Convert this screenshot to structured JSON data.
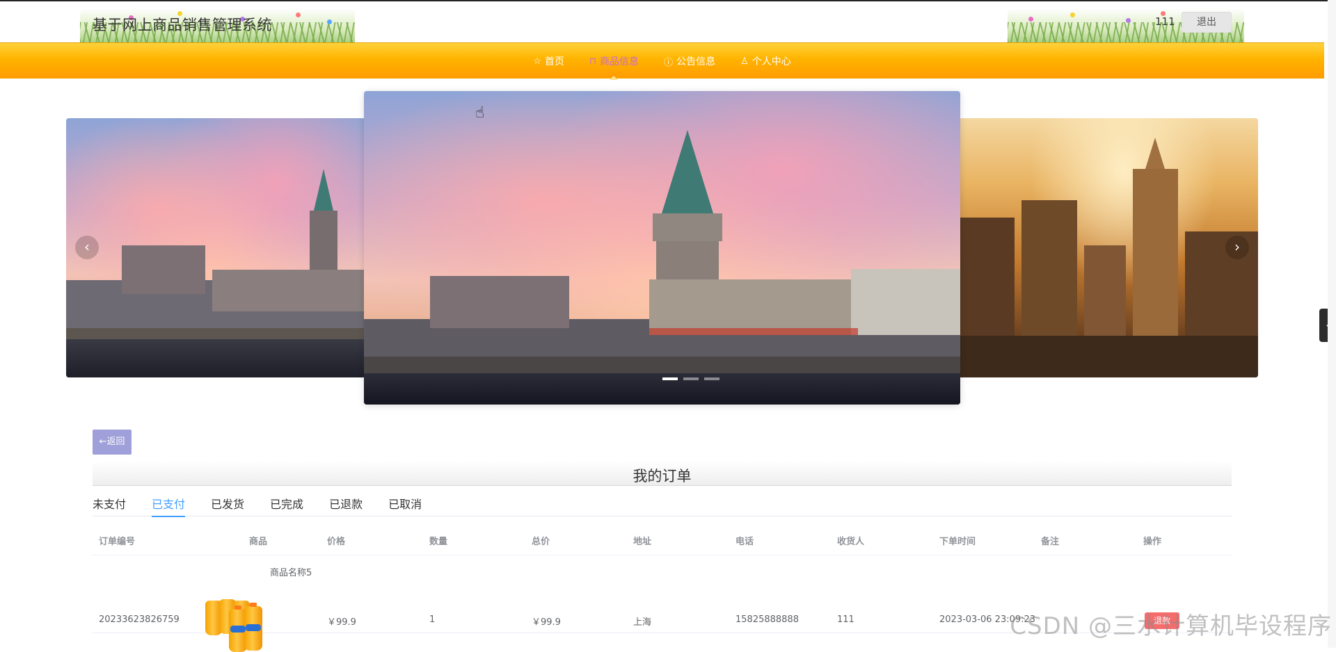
{
  "header": {
    "site_title": "基于网上商品销售管理系统",
    "user_name": "111",
    "logout_label": "退出"
  },
  "nav": {
    "items": [
      {
        "label": "首页",
        "icon": "star-icon",
        "active": false
      },
      {
        "label": "商品信息",
        "icon": "bag-icon",
        "active": true
      },
      {
        "label": "公告信息",
        "icon": "info-icon",
        "active": false
      },
      {
        "label": "个人中心",
        "icon": "user-icon",
        "active": false
      }
    ]
  },
  "carousel": {
    "prev_arrow": "‹",
    "next_arrow": "›",
    "active_index": 0,
    "slide_count": 3
  },
  "back_label": "←返回",
  "orders": {
    "title": "我的订单",
    "tabs": [
      {
        "label": "未支付",
        "active": false
      },
      {
        "label": "已支付",
        "active": true
      },
      {
        "label": "已发货",
        "active": false
      },
      {
        "label": "已完成",
        "active": false
      },
      {
        "label": "已退款",
        "active": false
      },
      {
        "label": "已取消",
        "active": false
      }
    ],
    "columns": {
      "order_no": "订单编号",
      "product": "商品",
      "price": "价格",
      "quantity": "数量",
      "total": "总价",
      "address": "地址",
      "phone": "电话",
      "receiver": "收货人",
      "order_time": "下单时间",
      "remark": "备注",
      "action": "操作"
    },
    "rows": [
      {
        "order_no": "20233623826759",
        "product_name": "商品名称5",
        "price": "￥99.9",
        "quantity": "1",
        "total": "￥99.9",
        "address": "上海",
        "phone": "15825888888",
        "receiver": "111",
        "order_time": "2023-03-06 23:09:23",
        "remark": "",
        "action_label": "退款"
      }
    ]
  },
  "watermark": "CSDN @三水计算机毕设程序",
  "side_tab": "‹",
  "colors": {
    "nav_gradient_top": "#ffd23a",
    "nav_gradient_bottom": "#ff9c00",
    "nav_active": "#c86ad7",
    "tab_active": "#409eff",
    "refund_button": "#f56c6c",
    "back_button": "#9f9fd9"
  }
}
